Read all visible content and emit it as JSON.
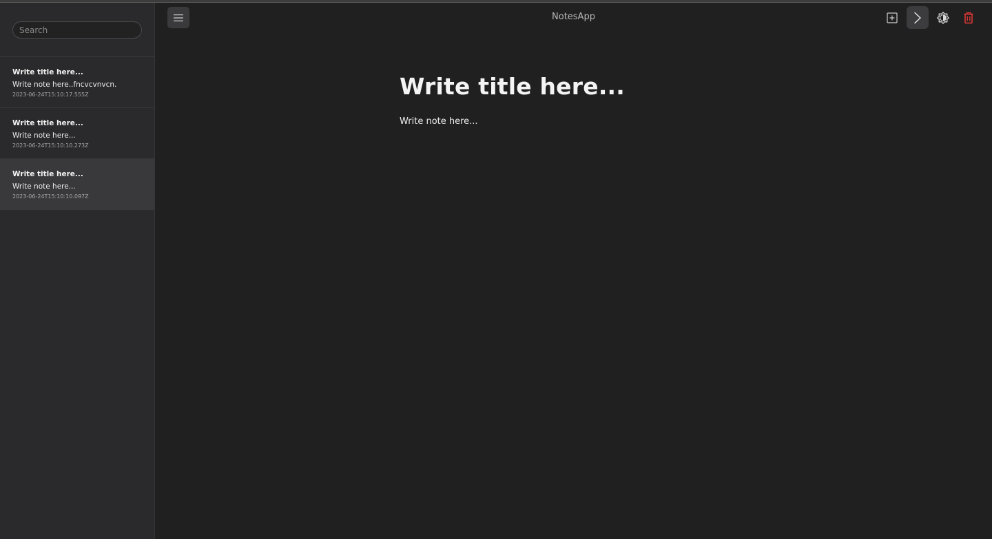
{
  "app": {
    "title": "NotesApp"
  },
  "search": {
    "placeholder": "Search",
    "value": ""
  },
  "notes": [
    {
      "title": "Write title here...",
      "body": "Write note here..fncvcvnvcn.",
      "date": "2023-06-24T15:10:17.555Z"
    },
    {
      "title": "Write title here...",
      "body": "Write note here...",
      "date": "2023-06-24T15:10:10.273Z"
    },
    {
      "title": "Write title here...",
      "body": "Write note here...",
      "date": "2023-06-24T15:10:10.097Z",
      "selected": true
    }
  ],
  "editor": {
    "title": "Write title here...",
    "body": "Write note here..."
  },
  "toolbar": {
    "icons": [
      "menu-icon",
      "add-note-icon",
      "chevron-right-icon",
      "theme-toggle-icon",
      "trash-icon"
    ],
    "accent_delete": "#e53935"
  },
  "colors": {
    "background": "#202020",
    "sidebar": "#2a2a2c",
    "selected_item": "#39393b"
  }
}
